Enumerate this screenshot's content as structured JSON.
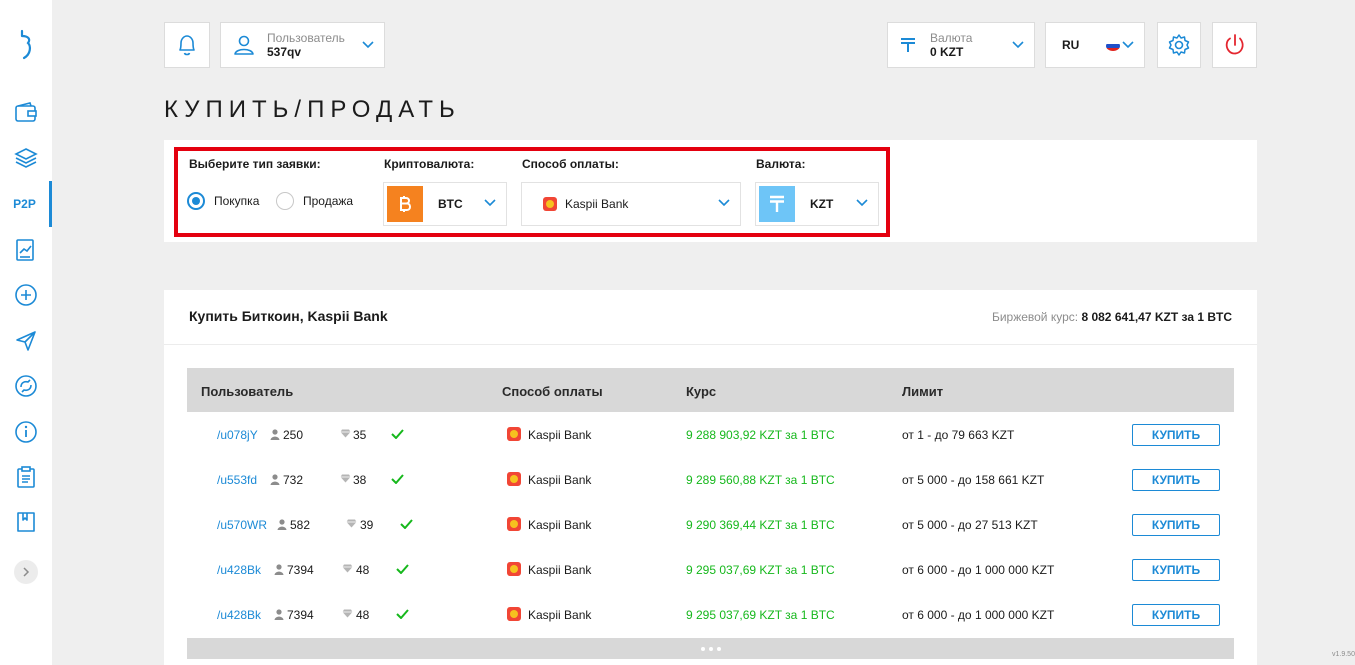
{
  "header": {
    "user_label": "Пользователь",
    "user_value": "537qv",
    "currency_label": "Валюта",
    "currency_value": "0 KZT",
    "language": "RU"
  },
  "page_title": "КУПИТЬ/ПРОДАТЬ",
  "sidebar": {
    "active_label": "P2P"
  },
  "filters": {
    "order_type_label": "Выберите тип заявки:",
    "buy_label": "Покупка",
    "sell_label": "Продажа",
    "selected_type": "buy",
    "crypto_label": "Криптовалюта:",
    "crypto_value": "BTC",
    "payment_label": "Способ оплаты:",
    "payment_value": "Kaspii Bank",
    "currency_label": "Валюта:",
    "currency_value": "KZT"
  },
  "offers": {
    "title": "Купить Биткоин, Kaspii Bank",
    "rate_label": "Биржевой курс:",
    "rate_value": "8 082 641,47 KZT за 1 BTC",
    "columns": {
      "user": "Пользователь",
      "method": "Способ оплаты",
      "rate": "Курс",
      "limit": "Лимит"
    },
    "buy_button": "КУПИТЬ",
    "rows": [
      {
        "user": "/u078jY",
        "deals": "250",
        "rating": "35",
        "method": "Kaspii Bank",
        "rate": "9 288 903,92 KZT за 1 BTC",
        "limit": "от 1 - до 79 663 KZT"
      },
      {
        "user": "/u553fd",
        "deals": "732",
        "rating": "38",
        "method": "Kaspii Bank",
        "rate": "9 289 560,88 KZT за 1 BTC",
        "limit": "от 5 000 - до 158 661 KZT"
      },
      {
        "user": "/u570WR",
        "deals": "582",
        "rating": "39",
        "method": "Kaspii Bank",
        "rate": "9 290 369,44 KZT за 1 BTC",
        "limit": "от 5 000 - до 27 513 KZT"
      },
      {
        "user": "/u428Bk",
        "deals": "7394",
        "rating": "48",
        "method": "Kaspii Bank",
        "rate": "9 295 037,69 KZT за 1 BTC",
        "limit": "от 6 000 - до 1 000 000 KZT"
      },
      {
        "user": "/u428Bk",
        "deals": "7394",
        "rating": "48",
        "method": "Kaspii Bank",
        "rate": "9 295 037,69 KZT за 1 BTC",
        "limit": "от 6 000 - до 1 000 000 KZT"
      }
    ]
  },
  "version": "v1.9.50",
  "colors": {
    "accent": "#1c8ad6",
    "rate_green": "#16b81c",
    "highlight_red": "#e4000f",
    "btc_orange": "#f5821f",
    "tenge_blue": "#6ec5f7"
  }
}
